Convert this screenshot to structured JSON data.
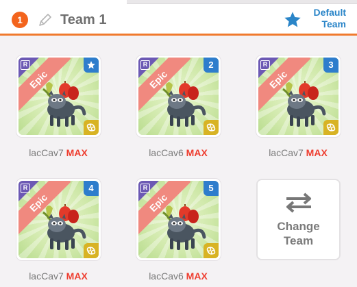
{
  "header": {
    "team_number": "1",
    "team_name": "Team 1",
    "default_label": "Default Team"
  },
  "colors": {
    "accent_orange": "#f07a2d",
    "link_blue": "#2a85c8",
    "max_red": "#ee3d2f",
    "rarity_purple": "#6c59b4",
    "ribbon_pink": "#f0897f",
    "slot_blue": "#2e7dcc",
    "element_gold": "#d8b324"
  },
  "pets": [
    {
      "slot": "",
      "slot_icon": "star-icon",
      "rarity": "Epic",
      "rarity_box": "R",
      "name": "lacCav7",
      "level": "MAX"
    },
    {
      "slot": "2",
      "rarity": "Epic",
      "rarity_box": "R",
      "name": "lacCav6",
      "level": "MAX"
    },
    {
      "slot": "3",
      "rarity": "Epic",
      "rarity_box": "R",
      "name": "lacCav7",
      "level": "MAX"
    },
    {
      "slot": "4",
      "rarity": "Epic",
      "rarity_box": "R",
      "name": "lacCav7",
      "level": "MAX"
    },
    {
      "slot": "5",
      "rarity": "Epic",
      "rarity_box": "R",
      "name": "lacCav6",
      "level": "MAX"
    }
  ],
  "change_team": {
    "label": "Change Team",
    "icon": "swap-arrows-icon"
  }
}
